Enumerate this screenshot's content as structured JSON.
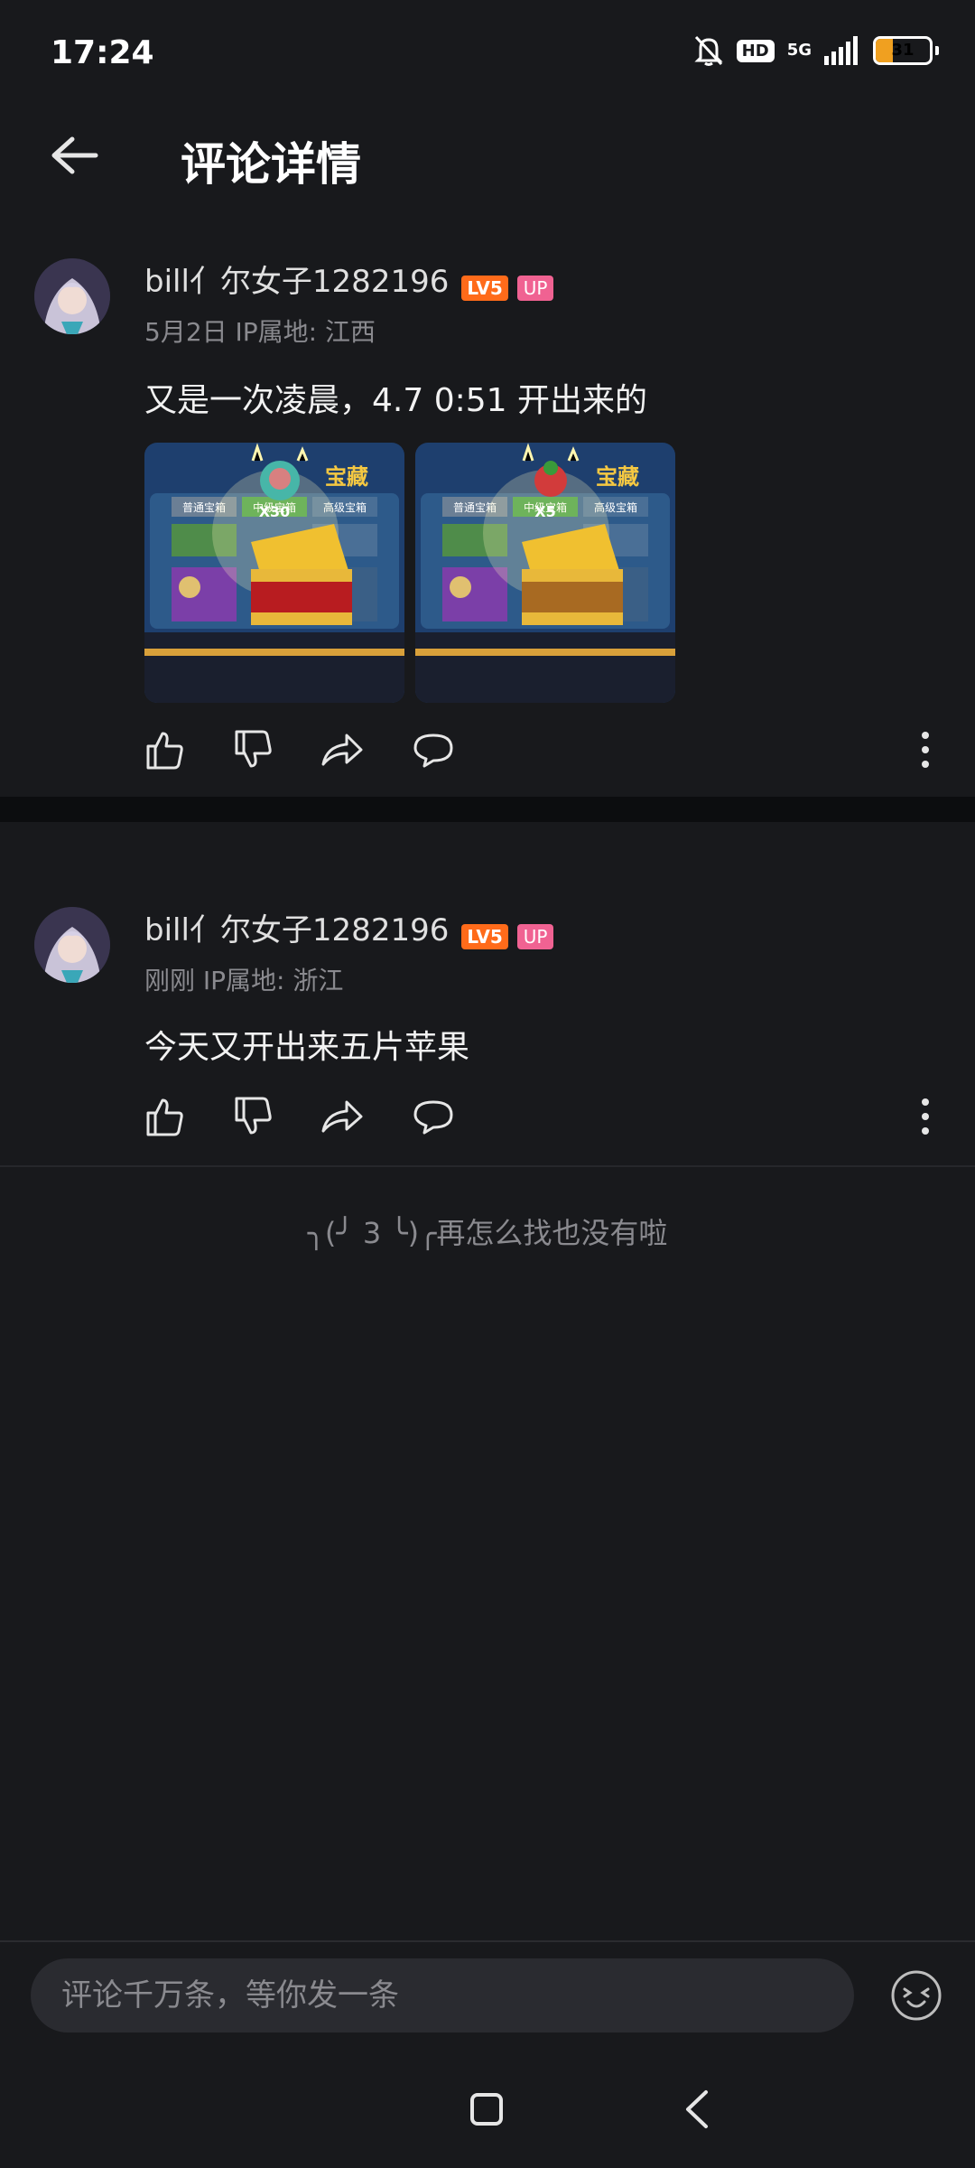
{
  "status_bar": {
    "time": "17:24",
    "hd": "HD",
    "network": "5G",
    "battery": "31",
    "battery_level": 0.31,
    "icons": [
      "bell-off-icon",
      "signal-icon",
      "battery-icon"
    ]
  },
  "header": {
    "title": "评论详情",
    "back_icon": "arrow-left-icon"
  },
  "comments": [
    {
      "username": "bill亻尔女子1282196",
      "level": "LV5",
      "up": "UP",
      "meta": "5月2日 IP属地: 江西",
      "content": "又是一次凌晨，4.7 0:51 开出来的",
      "images": [
        {
          "title": "宝藏",
          "tab_left": "普通宝箱",
          "tab_mid": "中级宝箱",
          "tab_right": "高级宝箱",
          "count": "X30"
        },
        {
          "title": "宝藏",
          "tab_left": "普通宝箱",
          "tab_mid": "中级宝箱",
          "tab_right": "高级宝箱",
          "count": "X5"
        }
      ]
    },
    {
      "username": "bill亻尔女子1282196",
      "level": "LV5",
      "up": "UP",
      "meta": "刚刚 IP属地: 浙江",
      "content": "今天又开出来五片苹果"
    }
  ],
  "actions": [
    "like-icon",
    "dislike-icon",
    "share-icon",
    "reply-icon",
    "more-icon"
  ],
  "end_message": "╮(╯ 3 ╰)╭再怎么找也没有啦",
  "input": {
    "placeholder": "评论千万条，等你发一条",
    "value": ""
  },
  "colors": {
    "background": "#18191c",
    "level_badge": "#ff6b1a",
    "up_badge": "#f06292",
    "battery": "#f0a020"
  }
}
